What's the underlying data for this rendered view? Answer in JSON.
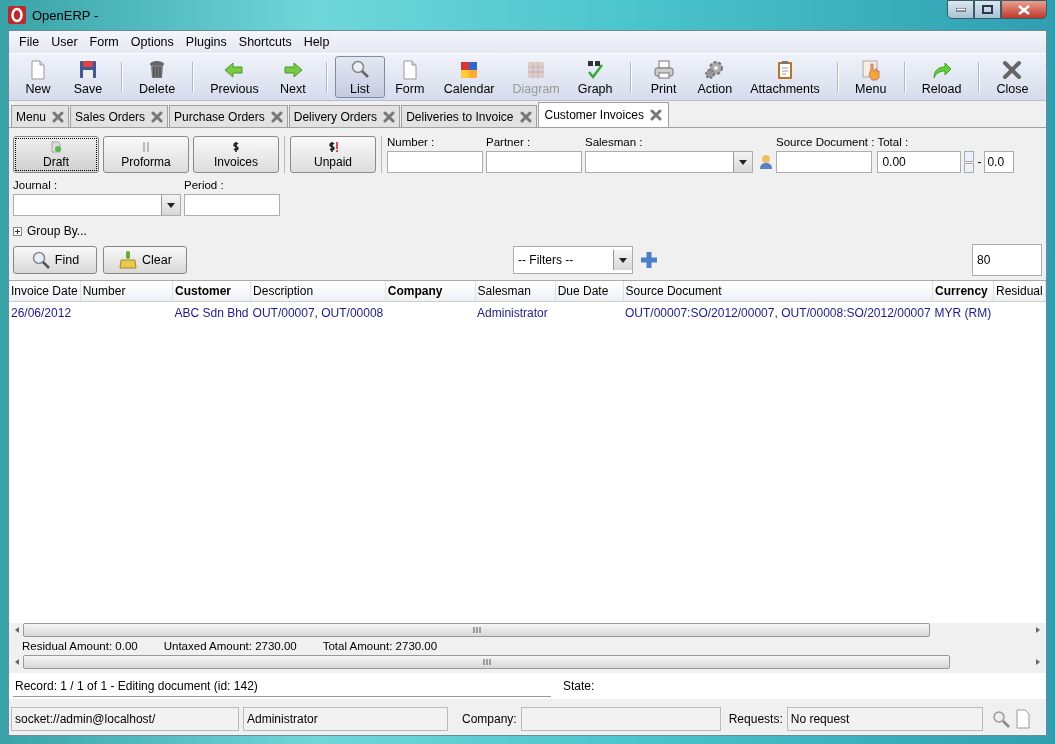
{
  "window": {
    "title": "OpenERP -"
  },
  "menu": [
    "File",
    "User",
    "Form",
    "Options",
    "Plugins",
    "Shortcuts",
    "Help"
  ],
  "toolbar": [
    [
      {
        "label": "New",
        "disabled": false,
        "selected": false
      },
      {
        "label": "Save",
        "disabled": false,
        "selected": false
      }
    ],
    [
      {
        "label": "Delete",
        "disabled": false,
        "selected": false
      }
    ],
    [
      {
        "label": "Previous",
        "disabled": false,
        "selected": false
      },
      {
        "label": "Next",
        "disabled": false,
        "selected": false
      }
    ],
    [
      {
        "label": "List",
        "disabled": false,
        "selected": true
      },
      {
        "label": "Form",
        "disabled": false,
        "selected": false
      },
      {
        "label": "Calendar",
        "disabled": false,
        "selected": false
      },
      {
        "label": "Diagram",
        "disabled": true,
        "selected": false
      },
      {
        "label": "Graph",
        "disabled": false,
        "selected": false
      }
    ],
    [
      {
        "label": "Print",
        "disabled": false,
        "selected": false
      },
      {
        "label": "Action",
        "disabled": false,
        "selected": false
      },
      {
        "label": "Attachments",
        "disabled": false,
        "selected": false
      }
    ],
    [
      {
        "label": "Menu",
        "disabled": false,
        "selected": false
      }
    ],
    [
      {
        "label": "Reload",
        "disabled": false,
        "selected": false
      }
    ],
    [
      {
        "label": "Close",
        "disabled": false,
        "selected": false
      }
    ]
  ],
  "tabs": [
    {
      "label": "Menu",
      "selected": false
    },
    {
      "label": "Sales Orders",
      "selected": false
    },
    {
      "label": "Purchase Orders",
      "selected": false
    },
    {
      "label": "Delivery Orders",
      "selected": false
    },
    {
      "label": "Deliveries to Invoice",
      "selected": false
    },
    {
      "label": "Customer Invoices",
      "selected": true
    }
  ],
  "state_filters": [
    [
      {
        "label": "Draft",
        "selected": true
      },
      {
        "label": "Proforma",
        "selected": false
      },
      {
        "label": "Invoices",
        "selected": false
      }
    ],
    [
      {
        "label": "Unpaid",
        "selected": false
      }
    ]
  ],
  "search_fields": [
    {
      "label": "Number :",
      "kind": "text"
    },
    {
      "label": "Partner :",
      "kind": "text"
    },
    {
      "label": "Salesman :",
      "kind": "user-select"
    },
    {
      "label": "Source Document :",
      "kind": "text"
    },
    {
      "label": "Total :",
      "kind": "range",
      "value": "0.00",
      "separator": "-",
      "value_to": "0.0"
    }
  ],
  "search_fields_2": [
    {
      "label": "Journal :",
      "kind": "select"
    },
    {
      "label": "Period :",
      "kind": "text"
    }
  ],
  "group_by": {
    "label": "Group By...",
    "expanded": false
  },
  "actions": [
    "Find",
    "Clear"
  ],
  "filters": {
    "value": "-- Filters --"
  },
  "limit": "80",
  "table": {
    "columns": [
      {
        "label": "Invoice Date",
        "bold": false
      },
      {
        "label": "Number",
        "bold": false
      },
      {
        "label": "Customer",
        "bold": true
      },
      {
        "label": "Description",
        "bold": false
      },
      {
        "label": "Company",
        "bold": true
      },
      {
        "label": "Salesman",
        "bold": false
      },
      {
        "label": "Due Date",
        "bold": false
      },
      {
        "label": "Source Document",
        "bold": false
      },
      {
        "label": "Currency",
        "bold": true
      },
      {
        "label": "Residual",
        "bold": false
      }
    ],
    "rows": [
      {
        "cells": [
          "26/06/2012",
          "",
          "ABC Sdn Bhd",
          "OUT/00007, OUT/00008",
          "",
          "Administrator",
          "",
          "OUT/00007:SO/2012/00007, OUT/00008:SO/2012/00007",
          "MYR (RM)",
          ""
        ]
      }
    ]
  },
  "totals": [
    "Residual Amount: 0.00",
    "Untaxed Amount: 2730.00",
    "Total Amount: 2730.00"
  ],
  "record": {
    "text": "Record: 1 / 1 of 1 - Editing document (id: 142)",
    "state_label": "State:"
  },
  "status_bar": {
    "connection": "socket://admin@localhost/",
    "user": "Administrator",
    "company_label": "Company:",
    "requests_label": "Requests:",
    "requests": "No request"
  }
}
